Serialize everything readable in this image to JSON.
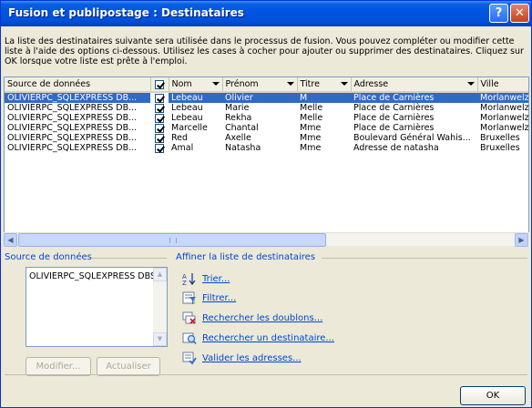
{
  "window": {
    "title": "Fusion et publipostage : Destinataires",
    "help_glyph": "?",
    "close_glyph": "✕"
  },
  "description": "La liste des destinataires suivante sera utilisée dans le processus de fusion. Vous pouvez compléter ou modifier cette liste à l'aide des options ci-dessous. Utilisez les cases à cocher pour ajouter ou supprimer des destinataires. Cliquez sur OK lorsque votre liste est prête à l'emploi.",
  "grid": {
    "columns": [
      "Source de données",
      "",
      "Nom",
      "Prénom",
      "Titre",
      "Adresse",
      "Ville"
    ],
    "rows": [
      {
        "source": "OLIVIERPC_SQLEXPRESS DB...",
        "checked": true,
        "nom": "Lebeau",
        "prenom": "Olivier",
        "titre": "M",
        "adresse": "Place de Carnières",
        "ville": "Morlanwelz",
        "selected": true
      },
      {
        "source": "OLIVIERPC_SQLEXPRESS DB...",
        "checked": true,
        "nom": "Lebeau",
        "prenom": "Marie",
        "titre": "Melle",
        "adresse": "Place de Carnières",
        "ville": "Morlanwelz",
        "selected": false
      },
      {
        "source": "OLIVIERPC_SQLEXPRESS DB...",
        "checked": true,
        "nom": "Lebeau",
        "prenom": "Rekha",
        "titre": "Melle",
        "adresse": "Place de Carnières",
        "ville": "Morlanwelz",
        "selected": false
      },
      {
        "source": "OLIVIERPC_SQLEXPRESS DB...",
        "checked": true,
        "nom": "Marcelle",
        "prenom": "Chantal",
        "titre": "Mme",
        "adresse": "Place de Carnières",
        "ville": "Morlanwelz",
        "selected": false
      },
      {
        "source": "OLIVIERPC_SQLEXPRESS DB...",
        "checked": true,
        "nom": "Red",
        "prenom": "Axelle",
        "titre": "Mme",
        "adresse": "Boulevard Général Wahis...",
        "ville": "Bruxelles",
        "selected": false
      },
      {
        "source": "OLIVIERPC_SQLEXPRESS DB...",
        "checked": true,
        "nom": "Amal",
        "prenom": "Natasha",
        "titre": "Mme",
        "adresse": "Adresse de natasha",
        "ville": "Bruxelles",
        "selected": false
      }
    ]
  },
  "datasource": {
    "label": "Source de données",
    "item": "OLIVIERPC_SQLEXPRESS DBSCIENCE",
    "modify_label": "Modifier...",
    "refresh_label": "Actualiser"
  },
  "refine": {
    "label": "Affiner la liste de destinataires",
    "actions": [
      {
        "label": "Trier...",
        "icon": "sort-az-icon"
      },
      {
        "label": "Filtrer...",
        "icon": "filter-icon"
      },
      {
        "label": "Rechercher les doublons...",
        "icon": "duplicates-icon"
      },
      {
        "label": "Rechercher un destinataire...",
        "icon": "find-recipient-icon"
      },
      {
        "label": "Valider les adresses...",
        "icon": "validate-addresses-icon"
      }
    ]
  },
  "ok_label": "OK",
  "colors": {
    "title_bar": "#0054e3",
    "selection": "#316ac5",
    "link": "#0046d5",
    "dialog_bg": "#ece9d8"
  }
}
